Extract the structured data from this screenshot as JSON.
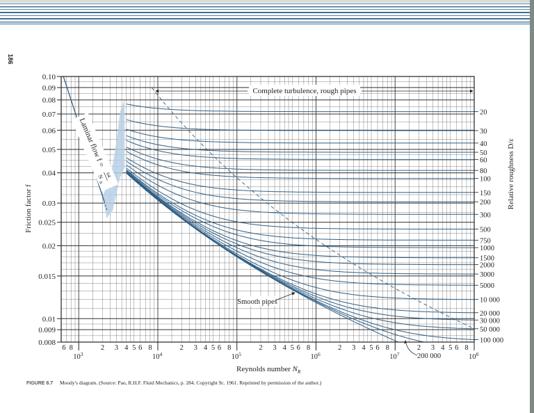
{
  "page": {
    "page_number": "186",
    "caption_label": "FIGURE 8.7",
    "caption_text": "Moody's diagram. (Source: Pao, R.H.F. Fluid Mechanics, p. 284. Copyright 9c. 1961. Reprinted by permission of the author.)"
  },
  "colors": {
    "curve": "#2f5f86",
    "grid": "#333333",
    "critical_zone": "#b9d0e6",
    "header_stripe": "#3d6f95"
  },
  "chart_data": {
    "type": "line",
    "title": "Moody's diagram",
    "xlabel": "Reynolds number N_R",
    "xlabel_main": "Reynolds number ",
    "xlabel_sub": "N",
    "xlabel_subscript": "R",
    "ylabel": "Friction factor f",
    "right_label": "Relative roughness D/ε",
    "xscale": "log",
    "yscale": "log",
    "xlim": [
      600,
      100000000
    ],
    "ylim": [
      0.008,
      0.1
    ],
    "grid": true,
    "y_ticks": [
      {
        "value": 0.1,
        "label": "0.10"
      },
      {
        "value": 0.09,
        "label": "0.09"
      },
      {
        "value": 0.08,
        "label": "0.08"
      },
      {
        "value": 0.07,
        "label": "0.07"
      },
      {
        "value": 0.06,
        "label": "0.06"
      },
      {
        "value": 0.05,
        "label": "0.05"
      },
      {
        "value": 0.04,
        "label": "0.04"
      },
      {
        "value": 0.03,
        "label": "0.03"
      },
      {
        "value": 0.025,
        "label": "0.025"
      },
      {
        "value": 0.02,
        "label": "0.02"
      },
      {
        "value": 0.015,
        "label": "0.015"
      },
      {
        "value": 0.01,
        "label": "0.01"
      },
      {
        "value": 0.009,
        "label": "0.009"
      },
      {
        "value": 0.008,
        "label": "0.008"
      }
    ],
    "x_minor_tick_labels": [
      "2",
      "3",
      "4",
      "5",
      "6",
      "8"
    ],
    "x_first_partial_labels": [
      {
        "value": 600,
        "label": "6"
      },
      {
        "value": 800,
        "label": "8"
      }
    ],
    "x_decades": [
      {
        "value": 1000,
        "base": "10",
        "exp": "3"
      },
      {
        "value": 10000,
        "base": "10",
        "exp": "4"
      },
      {
        "value": 100000,
        "base": "10",
        "exp": "5"
      },
      {
        "value": 1000000,
        "base": "10",
        "exp": "6"
      },
      {
        "value": 10000000,
        "base": "10",
        "exp": "7"
      },
      {
        "value": 100000000,
        "base": "10",
        "exp": "8"
      }
    ],
    "laminar": {
      "label": "Laminar flow f = 64/N_R",
      "label_main": "Laminar flow  f = ",
      "label_num": "64",
      "label_den": "N",
      "label_den_sub": "R",
      "coefficient": 64,
      "re_range": [
        600,
        2100
      ]
    },
    "critical_zone": [
      [
        2000,
        0.032
      ],
      [
        2250,
        0.026
      ],
      [
        2700,
        0.028
      ],
      [
        3300,
        0.038
      ],
      [
        3800,
        0.042
      ],
      [
        3800,
        0.08
      ],
      [
        3350,
        0.072
      ],
      [
        2900,
        0.05
      ],
      [
        2500,
        0.038
      ]
    ],
    "turbulent_re_range": [
      4000,
      100000000
    ],
    "relative_roughness_labels": [
      "20",
      "30",
      "40",
      "50",
      "60",
      "80",
      "100",
      "150",
      "200",
      "300",
      "500",
      "750",
      "1000",
      "1500",
      "2000",
      "3000",
      "5000",
      "10 000",
      "20 000",
      "30 000",
      "50 000",
      "100 000"
    ],
    "relative_roughness_values": [
      20,
      30,
      40,
      50,
      60,
      80,
      100,
      150,
      200,
      300,
      500,
      750,
      1000,
      1500,
      2000,
      3000,
      5000,
      10000,
      20000,
      30000,
      50000,
      100000
    ],
    "extra_curve": {
      "value": 200000,
      "label": "200 000"
    },
    "smooth_pipes_label": "Smooth pipes",
    "complete_turbulence_label": "Complete turbulence, rough pipes",
    "complete_turbulence_boundary": {
      "Re_sqrtf_eps_over_D": 200
    }
  }
}
